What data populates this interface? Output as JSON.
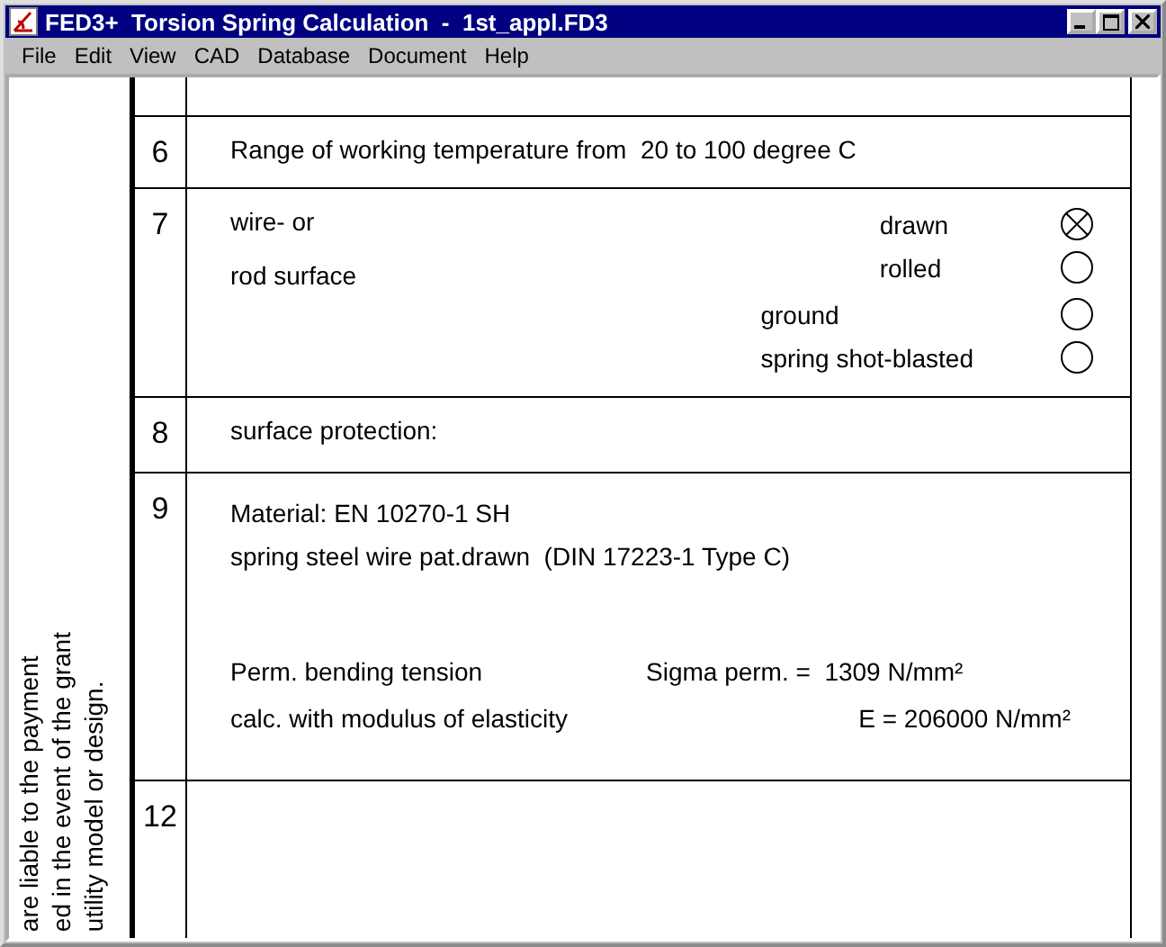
{
  "window": {
    "title": "FED3+  Torsion Spring Calculation  -  1st_appl.FD3"
  },
  "menu": [
    "File",
    "Edit",
    "View",
    "CAD",
    "Database",
    "Document",
    "Help"
  ],
  "margin_note": [
    "are liable to the payment",
    "ed in the event of the grant",
    "utility model or design."
  ],
  "rows": [
    {
      "kind": "blank"
    },
    {
      "kind": "text",
      "number": "6",
      "text": "Range of working temperature from  20 to 100 degree C"
    },
    {
      "kind": "options",
      "number": "7",
      "lines": [
        "wire- or",
        "rod surface"
      ],
      "option_groups": [
        [
          {
            "label": "drawn",
            "checked": true
          },
          {
            "label": "rolled",
            "checked": false
          }
        ],
        [
          {
            "label": "ground",
            "checked": false
          },
          {
            "label": "spring shot-blasted",
            "checked": false
          }
        ]
      ]
    },
    {
      "kind": "text",
      "number": "8",
      "text": "surface protection:"
    },
    {
      "kind": "material",
      "number": "9",
      "lines": [
        "Material: EN 10270-1 SH",
        "spring steel wire pat.drawn  (DIN 17223-1 Type C)"
      ],
      "values": [
        {
          "label": "Perm. bending tension",
          "value": "Sigma perm. =  1309 N/mm²"
        },
        {
          "label": "calc. with modulus of elasticity",
          "value": "E = 206000 N/mm²"
        }
      ]
    },
    {
      "kind": "blank",
      "number": "12"
    }
  ]
}
